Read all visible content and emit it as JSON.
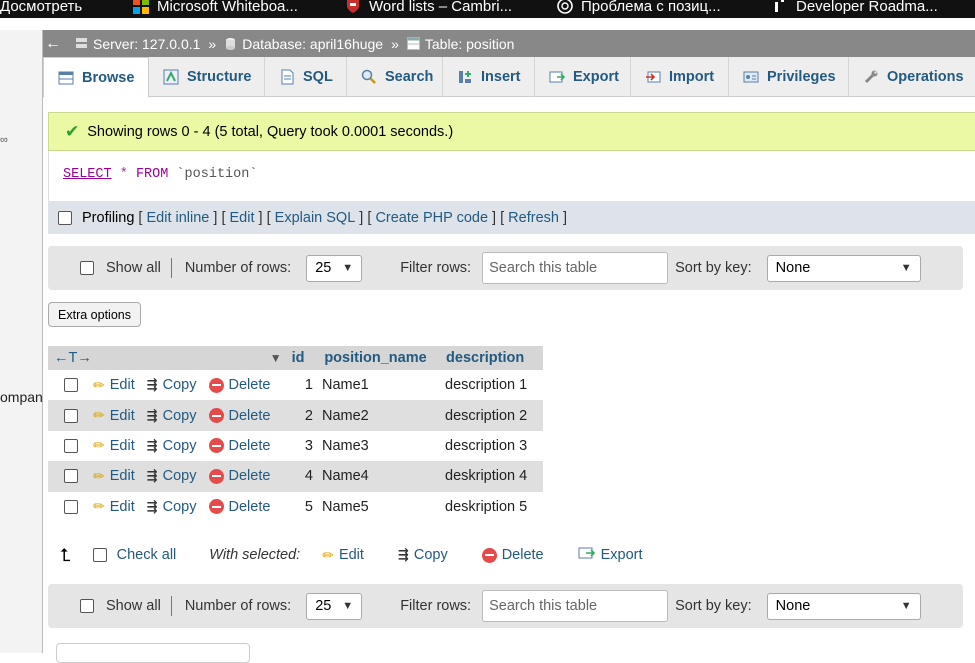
{
  "bookmarks": [
    {
      "label": "Досмотреть",
      "icon": "folder-icon"
    },
    {
      "label": "Microsoft Whiteboa...",
      "icon": "microsoft-icon"
    },
    {
      "label": "Word lists – Cambri...",
      "icon": "cambridge-icon"
    },
    {
      "label": "Проблема с позиц...",
      "icon": "openai-icon"
    },
    {
      "label": "Developer Roadma...",
      "icon": "roadmap-icon"
    }
  ],
  "leftnav": {
    "truncated_text": "ompan"
  },
  "breadcrumb": {
    "server": "Server: 127.0.0.1",
    "database": "Database: april16huge",
    "table": "Table: position",
    "separator": "»"
  },
  "tabs": [
    {
      "label": "Browse",
      "icon": "browse-icon"
    },
    {
      "label": "Structure",
      "icon": "structure-icon"
    },
    {
      "label": "SQL",
      "icon": "sql-icon"
    },
    {
      "label": "Search",
      "icon": "search-icon"
    },
    {
      "label": "Insert",
      "icon": "insert-icon"
    },
    {
      "label": "Export",
      "icon": "export-icon"
    },
    {
      "label": "Import",
      "icon": "import-icon"
    },
    {
      "label": "Privileges",
      "icon": "privileges-icon"
    },
    {
      "label": "Operations",
      "icon": "operations-icon"
    }
  ],
  "message": "Showing rows 0 - 4 (5 total, Query took 0.0001 seconds.)",
  "query": {
    "select": "SELECT",
    "star": "*",
    "from": "FROM",
    "table": "`position`"
  },
  "profiling": {
    "label": "Profiling",
    "edit_inline": "Edit inline",
    "edit": "Edit",
    "explain": "Explain SQL",
    "php": "Create PHP code",
    "refresh": "Refresh"
  },
  "nav": {
    "show_all": "Show all",
    "rows_label": "Number of rows:",
    "rows_value": "25",
    "filter_label": "Filter rows:",
    "filter_placeholder": "Search this table",
    "sort_label": "Sort by key:",
    "sort_value": "None"
  },
  "extra_options": "Extra options",
  "table": {
    "col_arrows": "←T→",
    "headers": [
      "id",
      "position_name",
      "description"
    ],
    "actions": {
      "edit": "Edit",
      "copy": "Copy",
      "delete": "Delete"
    },
    "rows": [
      {
        "id": "1",
        "name": "Name1",
        "desc": "description 1"
      },
      {
        "id": "2",
        "name": "Name2",
        "desc": "description 2"
      },
      {
        "id": "3",
        "name": "Name3",
        "desc": "description 3"
      },
      {
        "id": "4",
        "name": "Name4",
        "desc": "deskription 4"
      },
      {
        "id": "5",
        "name": "Name5",
        "desc": "deskription 5"
      }
    ]
  },
  "with_selected": {
    "check_all": "Check all",
    "label": "With selected:",
    "edit": "Edit",
    "copy": "Copy",
    "delete": "Delete",
    "export": "Export"
  }
}
